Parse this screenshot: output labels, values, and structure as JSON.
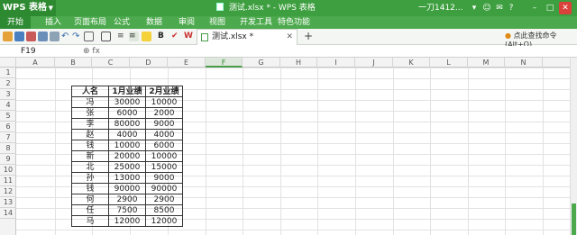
{
  "titlebar": {
    "app_button": "WPS 表格",
    "doc_title": "测试.xlsx * - WPS 表格",
    "user": "一刀1412..."
  },
  "menu": [
    "开始",
    "插入",
    "页面布局",
    "公式",
    "数据",
    "审阅",
    "视图",
    "开发工具",
    "特色功能"
  ],
  "doc_tab": {
    "name": "测试.xlsx *"
  },
  "command_search": "点此查找命令 (Alt+Q)",
  "formula_bar": {
    "cell_ref": "F19",
    "fx_icons": "⊕  fx",
    "value": ""
  },
  "columns": [
    "A",
    "B",
    "C",
    "D",
    "E",
    "F",
    "G",
    "H",
    "I",
    "J",
    "K",
    "L",
    "M",
    "N"
  ],
  "selected_column": "F",
  "rows": [
    "1",
    "2",
    "3",
    "4",
    "5",
    "6",
    "7",
    "8",
    "9",
    "10",
    "11",
    "12",
    "13",
    "14"
  ],
  "table": {
    "headers": [
      "人名",
      "1月业绩",
      "2月业绩"
    ],
    "rows": [
      [
        "冯",
        "30000",
        "10000"
      ],
      [
        "张",
        "6000",
        "2000"
      ],
      [
        "李",
        "80000",
        "9000"
      ],
      [
        "赵",
        "4000",
        "4000"
      ],
      [
        "钱",
        "10000",
        "6000"
      ],
      [
        "新",
        "20000",
        "10000"
      ],
      [
        "北",
        "25000",
        "15000"
      ],
      [
        "孙",
        "13000",
        "9000"
      ],
      [
        "钱",
        "90000",
        "90000"
      ],
      [
        "何",
        "2900",
        "2900"
      ],
      [
        "任",
        "7500",
        "8500"
      ],
      [
        "马",
        "12000",
        "12000"
      ]
    ]
  }
}
